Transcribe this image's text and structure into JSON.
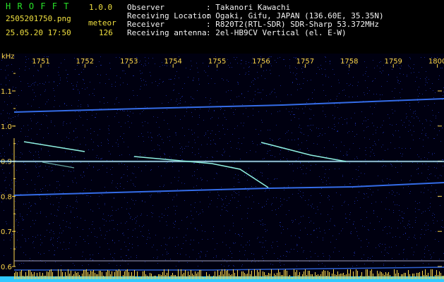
{
  "app": {
    "name": "H R O F F T",
    "version": "1.0.0",
    "filename": "2505201750.png",
    "datetime": "25.05.20 17:50",
    "mode": "meteor",
    "count": "126"
  },
  "info": {
    "labels": [
      "Observer",
      "Receiving Location",
      "Receiver",
      "Receiving antenna"
    ],
    "values": [
      ": Takanori Kawachi",
      ": Ogaki, Gifu, JAPAN (136.60E, 35.35N)",
      ": R820T2(RTL-SDR) SDR-Sharp 53.372MHz",
      ": 2el-HB9CV Vertical (el. E-W)"
    ]
  },
  "axis": {
    "y_unit": "kHz",
    "x_ticks": [
      "1751",
      "1752",
      "1753",
      "1754",
      "1755",
      "1756",
      "1757",
      "1758",
      "1759",
      "1800"
    ],
    "y_ticks": [
      "1.1",
      "1.0",
      "0.9",
      "0.8",
      "0.7",
      "0.6"
    ]
  },
  "colors": {
    "background": "#000010",
    "noise": "#1a2a9a",
    "trace": "#3a78ff",
    "meteor": "#8ff0e0",
    "carrier": "#ffffff",
    "yellow": "#ffd84a",
    "cyan": "#30c8ff",
    "green": "#28e228"
  }
}
